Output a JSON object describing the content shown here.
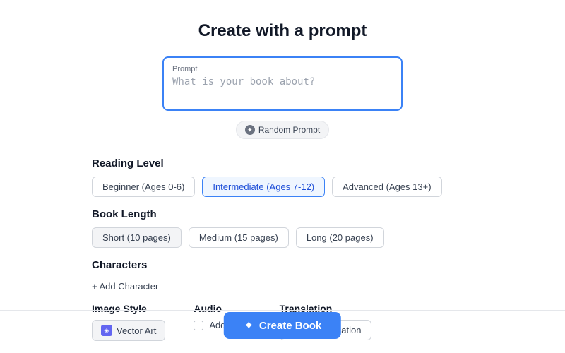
{
  "page": {
    "title": "Create with a prompt"
  },
  "prompt": {
    "label": "Prompt",
    "placeholder": "What is your book about?"
  },
  "random_prompt_btn": {
    "label": "Random Prompt"
  },
  "reading_level": {
    "label": "Reading Level",
    "options": [
      {
        "id": "beginner",
        "label": "Beginner (Ages 0-6)",
        "selected": false
      },
      {
        "id": "intermediate",
        "label": "Intermediate (Ages 7-12)",
        "selected": true
      },
      {
        "id": "advanced",
        "label": "Advanced (Ages 13+)",
        "selected": false
      }
    ]
  },
  "book_length": {
    "label": "Book Length",
    "options": [
      {
        "id": "short",
        "label": "Short (10 pages)",
        "selected": true
      },
      {
        "id": "medium",
        "label": "Medium (15 pages)",
        "selected": false
      },
      {
        "id": "long",
        "label": "Long (20 pages)",
        "selected": false
      }
    ]
  },
  "characters": {
    "label": "Characters",
    "add_btn": "+ Add Character"
  },
  "image_style": {
    "label": "Image Style",
    "selected": "Vector Art"
  },
  "audio": {
    "label": "Audio",
    "add_label": "Add Audio",
    "checked": false
  },
  "translation": {
    "label": "Translation",
    "btn_label": "+ Add Translation"
  },
  "create_book_btn": {
    "label": "Create Book",
    "icon": "✦"
  }
}
